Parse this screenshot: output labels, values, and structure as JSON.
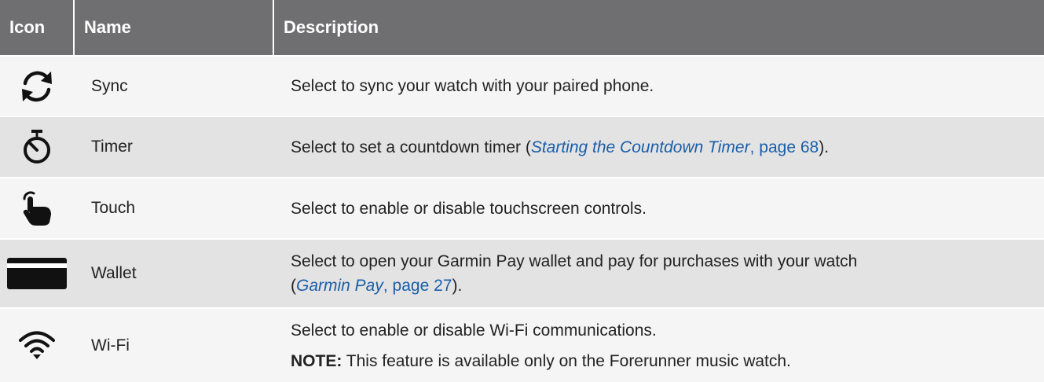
{
  "table": {
    "headers": {
      "icon": "Icon",
      "name": "Name",
      "description": "Description"
    },
    "rows": [
      {
        "icon": "sync-icon",
        "name": "Sync",
        "description": "Select to sync your watch with your paired phone."
      },
      {
        "icon": "timer-icon",
        "name": "Timer",
        "desc_before": "Select to set a countdown timer (",
        "desc_link_title": "Starting the Countdown Timer",
        "desc_link_page": ", page 68",
        "desc_after": ")."
      },
      {
        "icon": "touch-icon",
        "name": "Touch",
        "description": "Select to enable or disable touchscreen controls."
      },
      {
        "icon": "wallet-icon",
        "name": "Wallet",
        "desc_line1": "Select to open your Garmin Pay wallet and pay for purchases with your watch",
        "desc_open": "(",
        "desc_link_title": "Garmin Pay",
        "desc_link_page": ", page 27",
        "desc_after": ")."
      },
      {
        "icon": "wifi-icon",
        "name": "Wi-Fi",
        "description": "Select to enable or disable Wi-Fi communications.",
        "note_label": "NOTE:",
        "note_text": " This feature is available only on the Forerunner music watch."
      }
    ]
  },
  "colors": {
    "header_bg": "#6f6f71",
    "row_light": "#f5f5f5",
    "row_dark": "#e3e3e4",
    "link": "#1a5ea8"
  }
}
